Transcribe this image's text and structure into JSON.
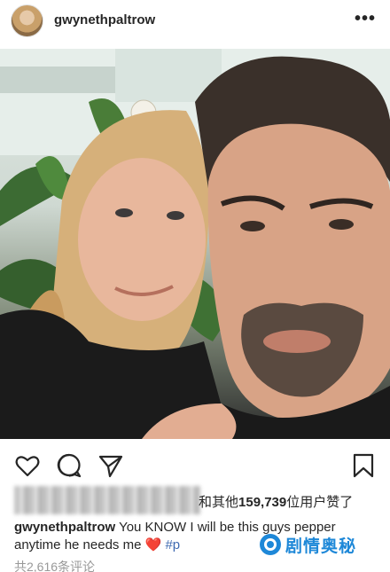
{
  "header": {
    "username": "gwynethpaltrow",
    "more_label": "•••",
    "more_icon": "more-options-icon"
  },
  "post": {
    "photo_description_icon": "photo",
    "actions": {
      "like_icon": "heart-outline-icon",
      "comment_icon": "comment-icon",
      "share_icon": "send-icon",
      "save_icon": "bookmark-icon"
    },
    "likes": {
      "prefix": "和其他",
      "count": "159,739",
      "suffix": "位用户赞了"
    },
    "caption": {
      "user": "gwynethpaltrow",
      "text_before_heart": " You KNOW I will be this guys pepper anytime he needs me ",
      "heart": "❤️",
      "hashtag": " #p"
    },
    "comments_label": "共2,616条评论"
  },
  "watermark": {
    "text": "剧情奥秘",
    "color": "#1e88d8"
  },
  "colors": {
    "text": "#262626",
    "muted": "#999999",
    "link": "#3f6ab1",
    "heart": "#e0245e"
  }
}
